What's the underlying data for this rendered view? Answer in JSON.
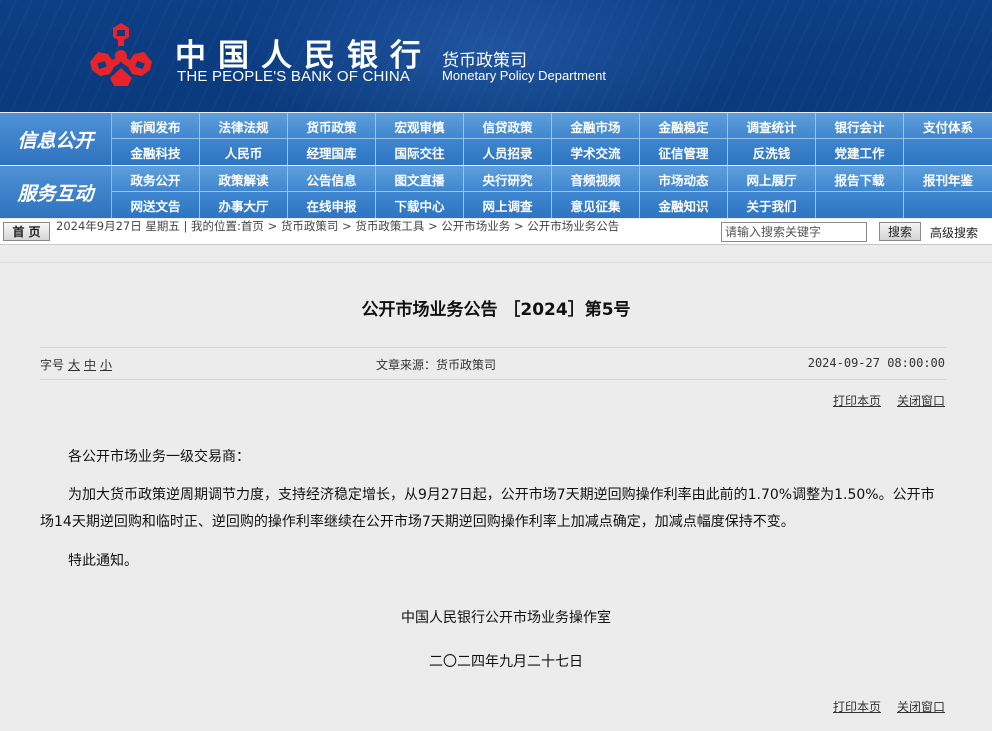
{
  "header": {
    "bank_name_cn": "中国人民银行",
    "bank_name_en": "THE PEOPLE'S BANK OF CHINA",
    "department_cn": "货币政策司",
    "department_en": "Monetary Policy Department",
    "emblem_color": "#e8232a",
    "banner_color": "#0b3c82"
  },
  "nav": {
    "group1_label": "信息公开",
    "group2_label": "服务互动",
    "group1_row1": [
      "新闻发布",
      "法律法规",
      "货币政策",
      "宏观审慎",
      "信贷政策",
      "金融市场",
      "金融稳定",
      "调查统计",
      "银行会计",
      "支付体系"
    ],
    "group1_row2": [
      "金融科技",
      "人民币",
      "经理国库",
      "国际交往",
      "人员招录",
      "学术交流",
      "征信管理",
      "反洗钱",
      "党建工作",
      ""
    ],
    "group2_row1": [
      "政务公开",
      "政策解读",
      "公告信息",
      "图文直播",
      "央行研究",
      "音频视频",
      "市场动态",
      "网上展厅",
      "报告下载",
      "报刊年鉴"
    ],
    "group2_row2": [
      "网送文告",
      "办事大厅",
      "在线申报",
      "下载中心",
      "网上调查",
      "意见征集",
      "金融知识",
      "关于我们",
      "",
      ""
    ]
  },
  "location_bar": {
    "home_label": "首页",
    "text": "2024年9月27日 星期五 | 我的位置:首页 > 货币政策司 > 货币政策工具 > 公开市场业务 > 公开市场业务公告",
    "search_placeholder": "请输入搜索关键字",
    "search_button": "搜索",
    "advanced_search": "高级搜索"
  },
  "article": {
    "title": "公开市场业务公告 ［2024］第5号",
    "font_size_label": "字号",
    "font_size_options": [
      "大",
      "中",
      "小"
    ],
    "source": "文章来源：货币政策司",
    "date": "2024-09-27 08:00:00",
    "print_label": "打印本页",
    "close_label": "关闭窗口",
    "salutation": "各公开市场业务一级交易商：",
    "body": "为加大货币政策逆周期调节力度，支持经济稳定增长，从9月27日起，公开市场7天期逆回购操作利率由此前的1.70%调整为1.50%。公开市场14天期逆回购和临时正、逆回购的操作利率继续在公开市场7天期逆回购操作利率上加减点确定，加减点幅度保持不变。",
    "notice": "特此通知。",
    "signature": "中国人民银行公开市场业务操作室",
    "sign_date": "二〇二四年九月二十七日"
  }
}
